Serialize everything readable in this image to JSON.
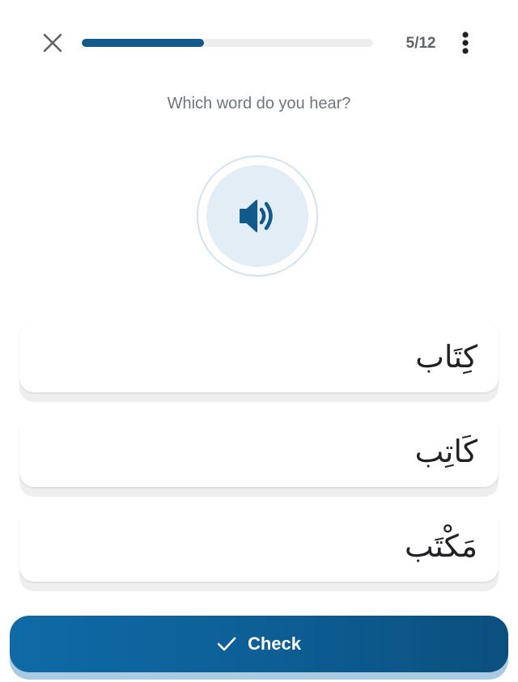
{
  "header": {
    "close_icon": "close-icon",
    "progress_fraction": 0.42,
    "progress_color": "#135a8c",
    "counter": "5/12",
    "menu_icon": "more-vertical-icon"
  },
  "prompt": "Which word do you hear?",
  "audio": {
    "icon": "speaker-icon",
    "accent_color": "#135a8c"
  },
  "options": [
    {
      "text": "كِتَاب"
    },
    {
      "text": "كَاتِب"
    },
    {
      "text": "مَكْتَب"
    }
  ],
  "check_button": {
    "icon": "checkmark-icon",
    "label": "Check"
  }
}
